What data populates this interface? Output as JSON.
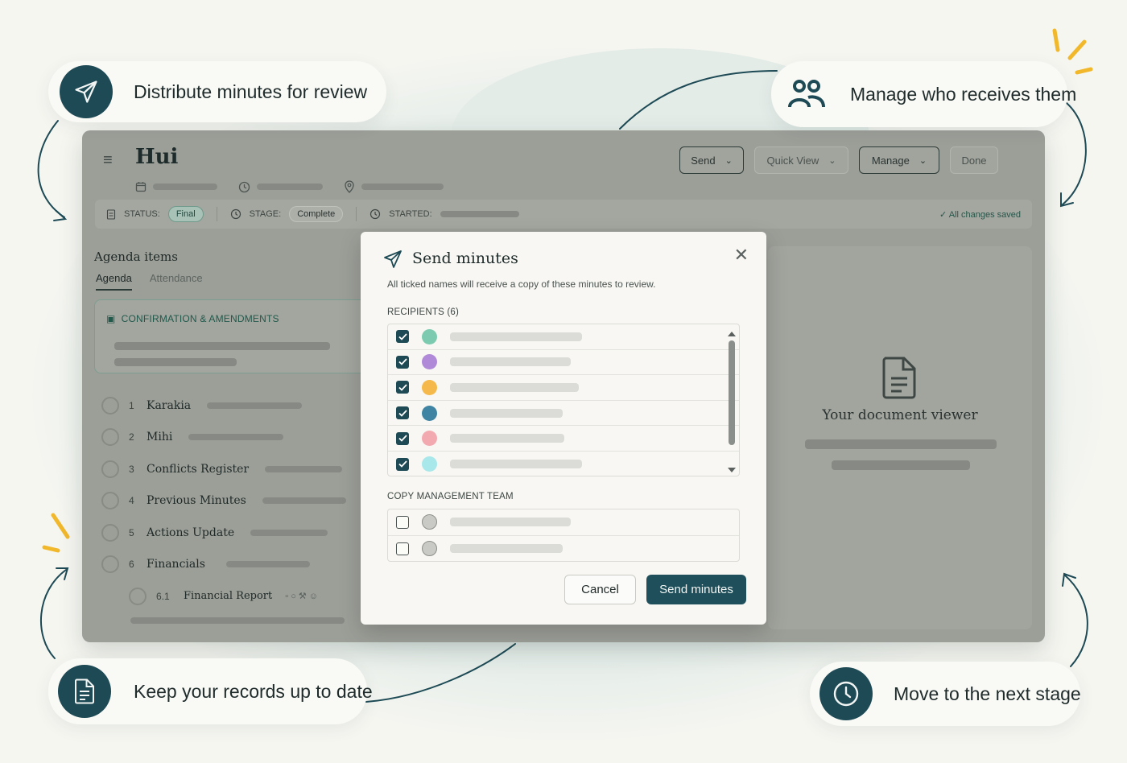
{
  "app": {
    "title": "Hui",
    "header_buttons": {
      "send": "Send",
      "quick_view": "Quick View",
      "manage": "Manage",
      "done": "Done"
    },
    "status": {
      "status_label": "STATUS:",
      "status_value": "Final",
      "stage_label": "STAGE:",
      "stage_value": "Complete",
      "started_label": "STARTED:",
      "saved": "✓  All changes saved"
    },
    "agenda": {
      "heading": "Agenda items",
      "tabs": [
        "Agenda",
        "Attendance"
      ],
      "confirmation_label": "CONFIRMATION & AMENDMENTS",
      "items": [
        {
          "num": "1",
          "name": "Karakia"
        },
        {
          "num": "2",
          "name": "Mihi"
        },
        {
          "num": "3",
          "name": "Conflicts Register"
        },
        {
          "num": "4",
          "name": "Previous Minutes"
        },
        {
          "num": "5",
          "name": "Actions Update"
        },
        {
          "num": "6",
          "name": "Financials"
        }
      ],
      "sub_item": {
        "num": "6.1",
        "name": "Financial Report"
      }
    },
    "viewer": {
      "title": "Your document viewer"
    }
  },
  "modal": {
    "title": "Send minutes",
    "description": "All ticked names will receive a copy of these minutes to review.",
    "recipients_label": "RECIPIENTS (6)",
    "recipients": [
      {
        "checked": true,
        "color": "#7ccbb0"
      },
      {
        "checked": true,
        "color": "#b08ad8"
      },
      {
        "checked": true,
        "color": "#f4b94a"
      },
      {
        "checked": true,
        "color": "#3f85a3"
      },
      {
        "checked": true,
        "color": "#f3a9b0"
      },
      {
        "checked": true,
        "color": "#a8e7ea"
      }
    ],
    "management_label": "COPY MANAGEMENT TEAM",
    "management": [
      {
        "checked": false,
        "color": "#c9c9c6"
      },
      {
        "checked": false,
        "color": "#c9c9c6"
      }
    ],
    "cancel": "Cancel",
    "send": "Send minutes"
  },
  "callouts": {
    "distribute": "Distribute minutes for review",
    "manage": "Manage who receives them",
    "records": "Keep your records up to date",
    "stage": "Move to the next stage"
  },
  "colors": {
    "accent": "#1d4a55",
    "highlight": "#f2b82c"
  }
}
